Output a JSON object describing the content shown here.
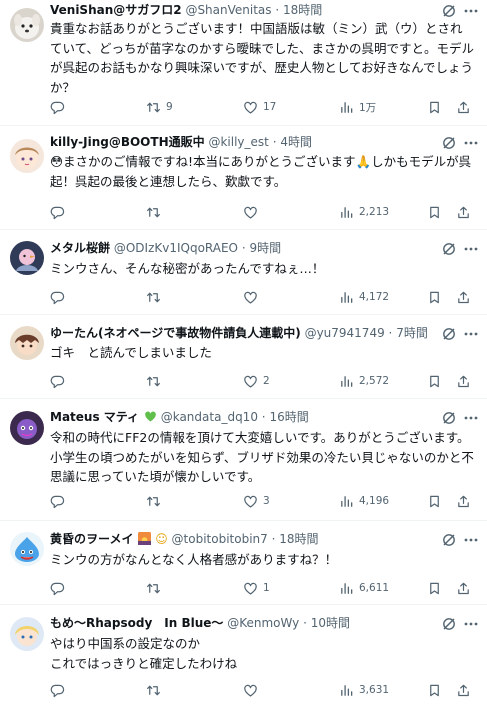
{
  "replies": [
    {
      "display_name": "VeniShan@サガフロ2",
      "handle": "@ShanVenitas",
      "time": "18時間",
      "text": "貴重なお話ありがとうございます！中国語版は敏（ミン）武（ウ）とされていて、どっちが苗字なのかすら曖昧でした、まさかの呉明ですと。モデルが呉起のお話もかなり興味深いですが、歴史人物としてお好きなんでしょうか？",
      "reposts": "9",
      "likes": "17",
      "views": "1万",
      "avatar": "white-dog-icon"
    },
    {
      "display_name": "killy-Jing@BOOTH通販中",
      "handle": "@killy_est",
      "time": "4時間",
      "text": "😳まさかのご情報ですね!本当にありがとうございます🙏しかもモデルが呉起！呉起の最後と連想したら、歎歔です。",
      "reposts": "",
      "likes": "",
      "views": "2,213",
      "avatar": "anime-girl-icon"
    },
    {
      "display_name": "メタル桜餅",
      "handle": "@ODIzKv1IQqoRAEO",
      "time": "9時間",
      "text": "ミンウさん、そんな秘密があったんですねぇ…！",
      "reposts": "",
      "likes": "",
      "views": "4,172",
      "avatar": "bird-icon"
    },
    {
      "display_name": "ゆーたん(ネオページで事故物件請負人連載中)",
      "handle": "@yu7941749",
      "time": "7時間",
      "text": "ゴキ　と読んでしまいました",
      "reposts": "",
      "likes": "2",
      "views": "2,572",
      "avatar": "anime-boy-icon"
    },
    {
      "display_name": "Mateus マティ",
      "handle": "@kandata_dq10",
      "time": "16時間",
      "text": "令和の時代にFF2の情報を頂けて大変嬉しいです。ありがとうございます。\n小学生の頃つめたがいを知らず、ブリザド効果の冷たい貝じゃないのかと不思議に思っていた頃が懐かしいです。",
      "reposts": "",
      "likes": "3",
      "views": "4,196",
      "avatar": "purple-character-icon",
      "emoji": "green-heart-icon"
    },
    {
      "display_name": "黄昏のヲーメイ",
      "handle": "@tobitobitobin7",
      "time": "18時間",
      "text": "ミンウの方がなんとなく人格者感がありますね？！",
      "reposts": "",
      "likes": "1",
      "views": "6,611",
      "avatar": "blue-slime-icon",
      "emoji": "sunset-emoji-icon"
    },
    {
      "display_name": "もめ～Rhapsody　In Blue～",
      "handle": "@KenmoWy",
      "time": "10時間",
      "text": "やはり中国系の設定なのか\nこれではっきりと確定したわけね",
      "reposts": "",
      "likes": "",
      "views": "3,631",
      "avatar": "anime-girl-blue-icon"
    }
  ],
  "colors": {
    "text": "#0f1419",
    "secondary": "#536471",
    "divider": "#eff3f4"
  }
}
